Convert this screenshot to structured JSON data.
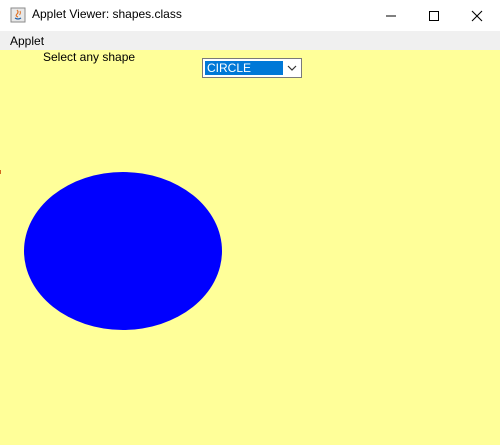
{
  "window": {
    "title": "Applet Viewer: shapes.class",
    "icon": "java-applet-icon",
    "controls": [
      "minimize-icon",
      "maximize-icon",
      "close-icon"
    ]
  },
  "menubar": {
    "items": [
      {
        "label": "Applet"
      }
    ]
  },
  "applet": {
    "background": "#ffff99",
    "prompt": "Select any shape",
    "choice": {
      "selected": "CIRCLE",
      "highlight": "#0078d7"
    },
    "shape": {
      "type": "circle",
      "fill": "#0000ff"
    }
  }
}
